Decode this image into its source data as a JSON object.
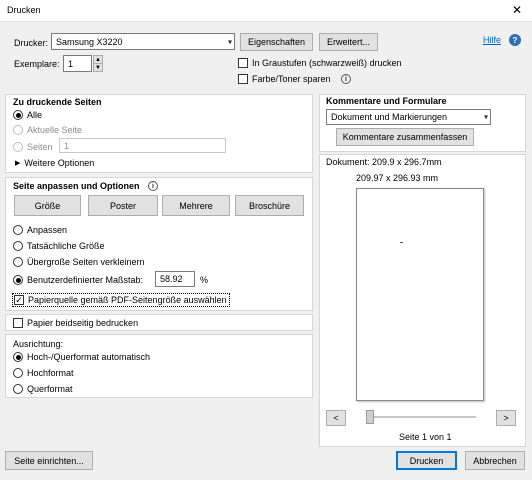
{
  "window": {
    "title": "Drucken",
    "close_glyph": "✕"
  },
  "header": {
    "printer_label": "Drucker:",
    "printer_value": "Samsung X3220",
    "properties_button": "Eigenschaften",
    "advanced_button": "Erweitert...",
    "help_link": "Hilfe",
    "help_icon_glyph": "?",
    "copies_label": "Exemplare:",
    "copies_value": "1",
    "grayscale_label": "In Graustufen (schwarzweiß) drucken",
    "grayscale_checked": false,
    "save_ink_label": "Farbe/Toner sparen",
    "save_ink_checked": false
  },
  "pages_section": {
    "title": "Zu druckende Seiten",
    "options": [
      {
        "label": "Alle",
        "selected": true,
        "disabled": false
      },
      {
        "label": "Aktuelle Seite",
        "selected": false,
        "disabled": true
      },
      {
        "label": "Seiten",
        "selected": false,
        "disabled": true
      }
    ],
    "pages_input_value": "1",
    "more_options": "Weitere Optionen"
  },
  "scale_section": {
    "title": "Seite anpassen und Optionen",
    "tabs": [
      "Größe",
      "Poster",
      "Mehrere",
      "Broschüre"
    ],
    "options": [
      {
        "label": "Anpassen",
        "selected": false
      },
      {
        "label": "Tatsächliche Größe",
        "selected": false
      },
      {
        "label": "Übergroße Seiten verkleinern",
        "selected": false
      },
      {
        "label": "Benutzerdefinierter Maßstab:",
        "selected": true
      }
    ],
    "scale_value": "58.92",
    "scale_unit": "%",
    "paper_source_label": "Papierquelle gemäß PDF-Seitengröße auswählen",
    "paper_source_checked": true
  },
  "duplex": {
    "label": "Papier beidseitig bedrucken",
    "checked": false
  },
  "orientation": {
    "title": "Ausrichtung:",
    "options": [
      {
        "label": "Hoch-/Querformat automatisch",
        "selected": true
      },
      {
        "label": "Hochformat",
        "selected": false
      },
      {
        "label": "Querformat",
        "selected": false
      }
    ]
  },
  "comments": {
    "title": "Kommentare und Formulare",
    "select_value": "Dokument und Markierungen",
    "summarize_button": "Kommentare zusammenfassen"
  },
  "preview": {
    "document_size": "Dokument: 209.9 x 296.7mm",
    "paper_size": "209.97 x 296.93 mm",
    "prev_glyph": "<",
    "next_glyph": ">",
    "page_status": "Seite 1 von 1"
  },
  "footer": {
    "page_setup_button": "Seite einrichten...",
    "print_button": "Drucken",
    "cancel_button": "Abbrechen"
  },
  "colors": {
    "accent": "#0078d7",
    "link": "#0066cc",
    "background": "#f0f0f0"
  }
}
